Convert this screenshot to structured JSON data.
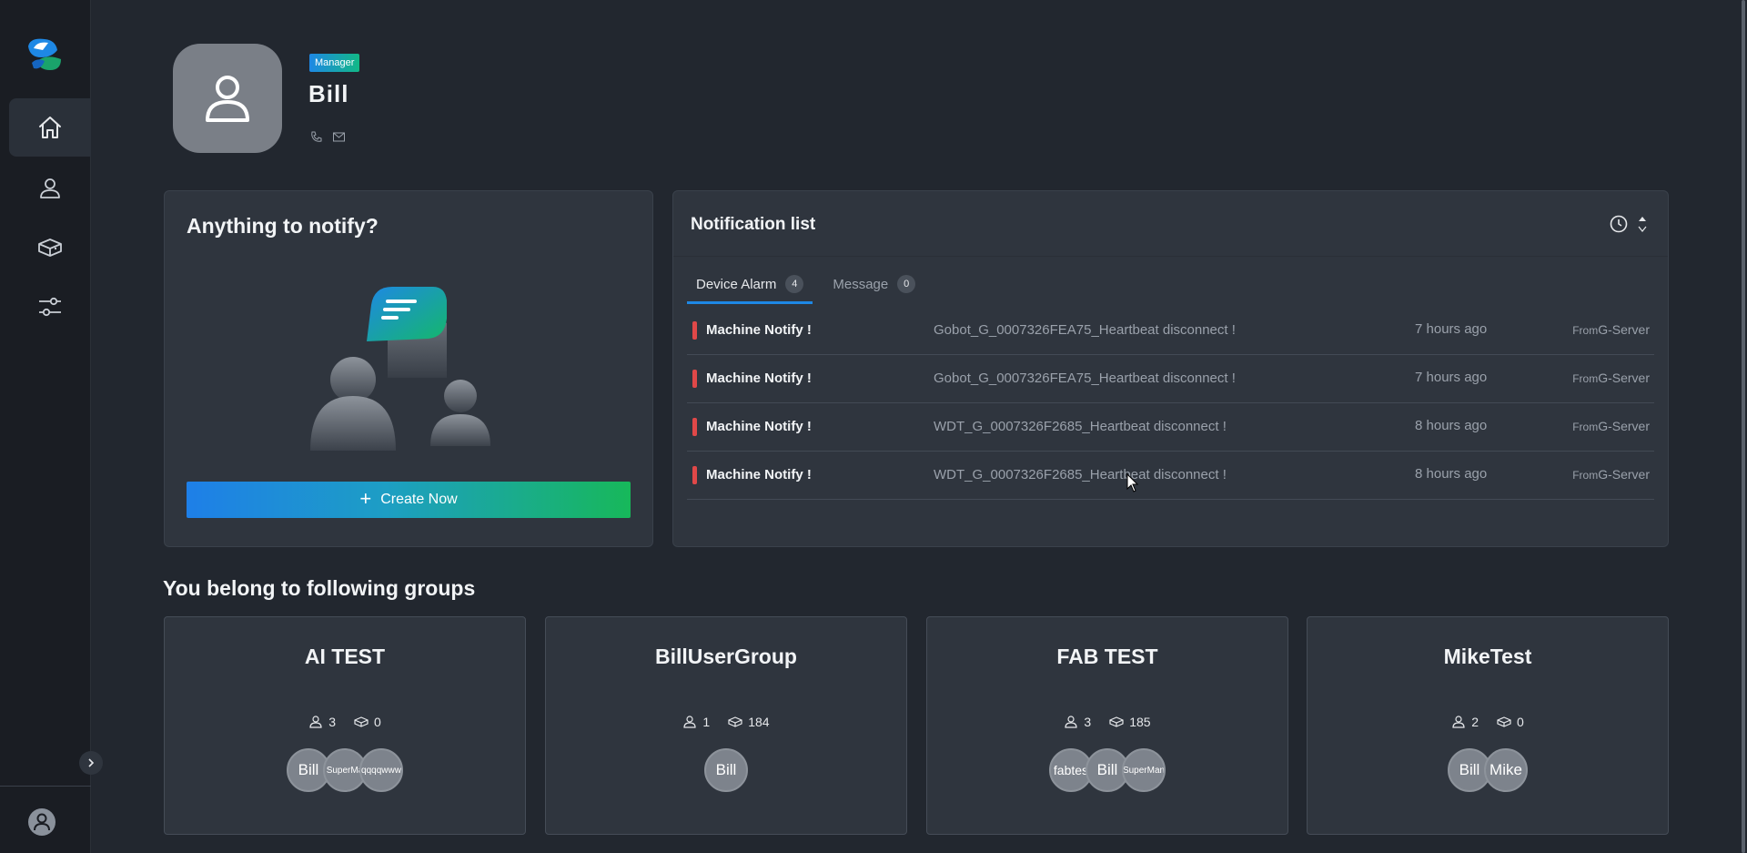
{
  "sidebar": {
    "items": [
      {
        "icon": "home-icon",
        "active": true
      },
      {
        "icon": "user-icon",
        "active": false
      },
      {
        "icon": "device-icon",
        "active": false
      },
      {
        "icon": "settings-sliders-icon",
        "active": false
      }
    ]
  },
  "profile": {
    "role": "Manager",
    "name": "Bill"
  },
  "notify_card": {
    "title": "Anything to notify?",
    "button_label": "Create Now"
  },
  "notification_list": {
    "title": "Notification list",
    "tabs": [
      {
        "label": "Device Alarm",
        "count": "4",
        "active": true
      },
      {
        "label": "Message",
        "count": "0",
        "active": false
      }
    ],
    "rows": [
      {
        "title": "Machine Notify !",
        "message": "Gobot_G_0007326FEA75_Heartbeat disconnect !",
        "time": "7 hours ago",
        "from_prefix": "From",
        "from": "G-Server"
      },
      {
        "title": "Machine Notify !",
        "message": "Gobot_G_0007326FEA75_Heartbeat disconnect !",
        "time": "7 hours ago",
        "from_prefix": "From",
        "from": "G-Server"
      },
      {
        "title": "Machine Notify !",
        "message": "WDT_G_0007326F2685_Heartbeat disconnect !",
        "time": "8 hours ago",
        "from_prefix": "From",
        "from": "G-Server"
      },
      {
        "title": "Machine Notify !",
        "message": "WDT_G_0007326F2685_Heartbeat disconnect !",
        "time": "8 hours ago",
        "from_prefix": "From",
        "from": "G-Server"
      }
    ]
  },
  "groups": {
    "title": "You belong to following groups",
    "items": [
      {
        "name": "AI TEST",
        "users": "3",
        "devices": "0",
        "members": [
          "Bill",
          "SuperMa",
          "qqqqwww"
        ]
      },
      {
        "name": "BillUserGroup",
        "users": "1",
        "devices": "184",
        "members": [
          "Bill"
        ]
      },
      {
        "name": "FAB TEST",
        "users": "3",
        "devices": "185",
        "members": [
          "fabtes",
          "Bill",
          "SuperMan"
        ]
      },
      {
        "name": "MikeTest",
        "users": "2",
        "devices": "0",
        "members": [
          "Bill",
          "Mike"
        ]
      }
    ]
  },
  "colors": {
    "background": "#22272f",
    "sidebar": "#1a1d23",
    "card": "#2f353e",
    "accent": "#1e88e5",
    "gradient_end": "#17b85a",
    "alarm": "#e04848"
  }
}
